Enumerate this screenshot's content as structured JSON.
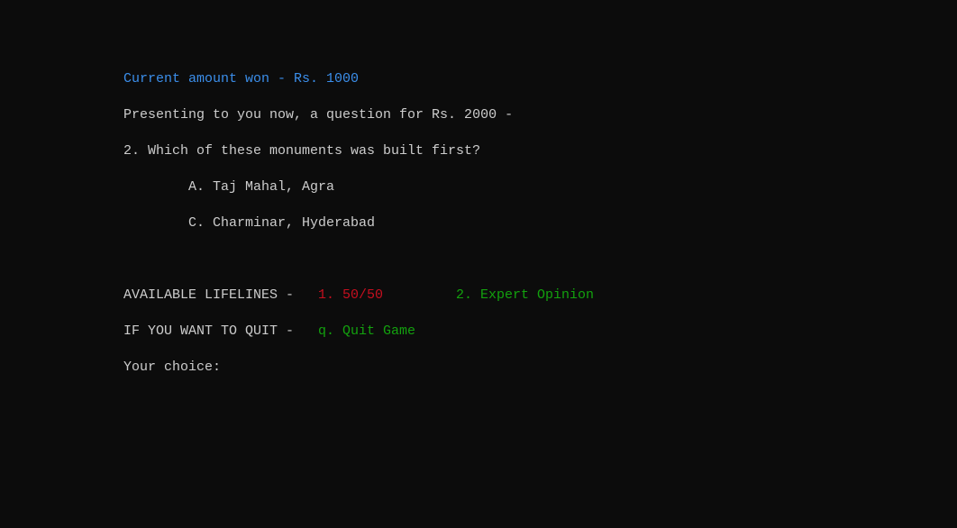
{
  "terminal": {
    "current_amount": "Current amount won - Rs. 1000",
    "presenting": "Presenting to you now, a question for Rs. 2000 -",
    "question": "2. Which of these monuments was built first?",
    "options": [
      {
        "label": "A. Taj Mahal, Agra"
      },
      {
        "label": "C. Charminar, Hyderabad"
      }
    ],
    "lifelines_label": "AVAILABLE LIFELINES -",
    "lifelines": [
      {
        "label": "1. 50/50",
        "color": "#c50f1f",
        "state": "used"
      },
      {
        "label": "2. Expert Opinion",
        "color": "#13a10e",
        "state": "available"
      }
    ],
    "quit_label": "IF YOU WANT TO QUIT -",
    "quit_option": "q. Quit Game",
    "prompt": "Your choice:"
  },
  "colors": {
    "background": "#0c0c0c",
    "text": "#cccccc",
    "info": "#3b8eea",
    "used": "#c50f1f",
    "available": "#13a10e"
  }
}
